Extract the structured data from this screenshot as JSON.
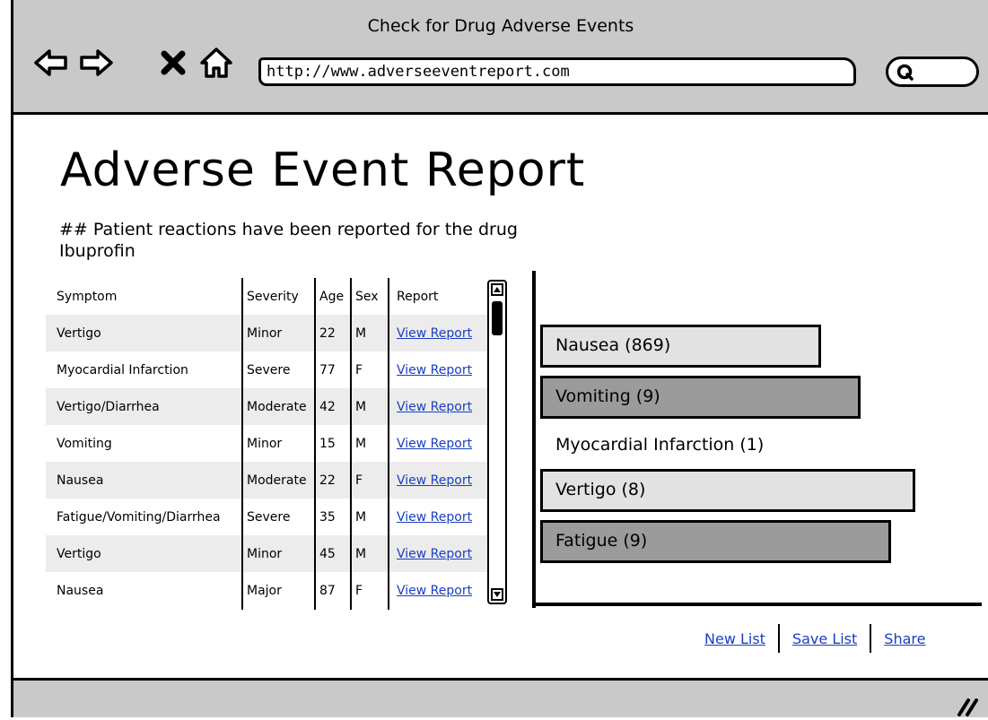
{
  "window": {
    "title": "Check for Drug Adverse Events",
    "url": "http://www.adverseeventreport.com"
  },
  "page": {
    "title": "Adverse Event Report",
    "subtitle_line1": "## Patient reactions have been reported for the drug",
    "subtitle_line2": "Ibuprofin"
  },
  "table": {
    "headers": [
      "Symptom",
      "Severity",
      "Age",
      "Sex",
      "Report"
    ],
    "rows": [
      {
        "symptom": "Vertigo",
        "severity": "Minor",
        "age": "22",
        "sex": "M",
        "report": "View Report"
      },
      {
        "symptom": "Myocardial Infarction",
        "severity": "Severe",
        "age": "77",
        "sex": "F",
        "report": "View Report"
      },
      {
        "symptom": "Vertigo/Diarrhea",
        "severity": "Moderate",
        "age": "42",
        "sex": "M",
        "report": "View Report"
      },
      {
        "symptom": "Vomiting",
        "severity": "Minor",
        "age": "15",
        "sex": "M",
        "report": "View Report"
      },
      {
        "symptom": "Nausea",
        "severity": "Moderate",
        "age": "22",
        "sex": "F",
        "report": "View Report"
      },
      {
        "symptom": "Fatigue/Vomiting/Diarrhea",
        "severity": "Severe",
        "age": "35",
        "sex": "M",
        "report": "View Report"
      },
      {
        "symptom": "Vertigo",
        "severity": "Minor",
        "age": "45",
        "sex": "M",
        "report": "View Report"
      },
      {
        "symptom": "Nausea",
        "severity": "Major",
        "age": "87",
        "sex": "F",
        "report": "View Report"
      }
    ]
  },
  "chart": {
    "bars": [
      {
        "label": "Nausea (869)",
        "style": "light"
      },
      {
        "label": "Vomiting (9)",
        "style": "dark"
      },
      {
        "label": "Myocardial Infarction (1)",
        "style": "none"
      },
      {
        "label": "Vertigo (8)",
        "style": "light"
      },
      {
        "label": "Fatigue (9)",
        "style": "dark"
      }
    ]
  },
  "actions": {
    "new_list": "New List",
    "save_list": "Save List",
    "share": "Share"
  },
  "colors": {
    "chrome": "#c9c9c9",
    "link": "#1a3fbf",
    "bar_light": "#e2e2e2",
    "bar_dark": "#9b9b9b"
  }
}
